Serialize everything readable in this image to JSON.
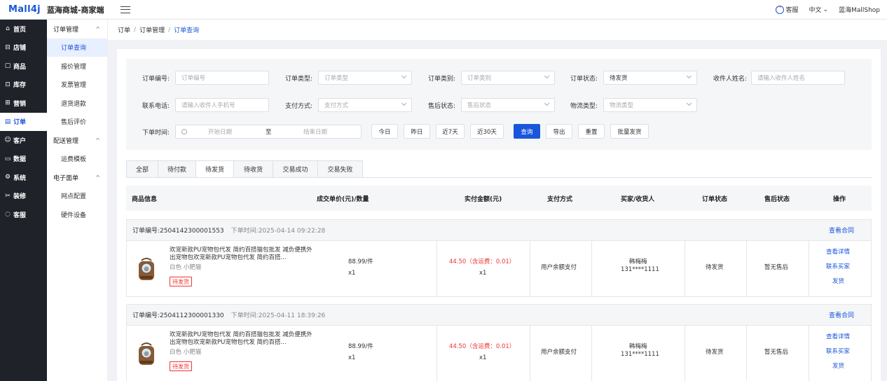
{
  "header": {
    "logo": "Mall4j",
    "title": "蓝海商城-商家端",
    "service": "客服",
    "language": "中文",
    "shop": "蓝海MallShop"
  },
  "sidebar": {
    "items": [
      {
        "icon": "home-icon",
        "label": "首页"
      },
      {
        "icon": "store-icon",
        "label": "店铺"
      },
      {
        "icon": "goods-icon",
        "label": "商品"
      },
      {
        "icon": "warehouse-icon",
        "label": "库存"
      },
      {
        "icon": "gift-icon",
        "label": "营销"
      },
      {
        "icon": "order-icon",
        "label": "订单"
      },
      {
        "icon": "customer-icon",
        "label": "客户"
      },
      {
        "icon": "data-icon",
        "label": "数据"
      },
      {
        "icon": "system-icon",
        "label": "系统"
      },
      {
        "icon": "decorate-icon",
        "label": "装修"
      },
      {
        "icon": "chat-icon",
        "label": "客服"
      }
    ]
  },
  "submenu": {
    "groups": [
      {
        "title": "订单管理",
        "items": [
          "订单查询",
          "报价管理",
          "发票管理",
          "退货退款",
          "售后评价"
        ]
      },
      {
        "title": "配送管理",
        "items": [
          "运费模板"
        ]
      },
      {
        "title": "电子面单",
        "items": [
          "网点配置",
          "硬件设备"
        ]
      }
    ]
  },
  "breadcrumb": [
    "订单",
    "订单管理",
    "订单查询"
  ],
  "filters": {
    "order_no": {
      "label": "订单编号:",
      "placeholder": "订单编号"
    },
    "order_type": {
      "label": "订单类型:",
      "placeholder": "订单类型"
    },
    "order_category": {
      "label": "订单类别:",
      "placeholder": "订单类别"
    },
    "order_status": {
      "label": "订单状态:",
      "value": "待发货"
    },
    "receiver_name": {
      "label": "收件人姓名:",
      "placeholder": "请输入收件人姓名"
    },
    "phone": {
      "label": "联系电话:",
      "placeholder": "请输入收件人手机号"
    },
    "pay_method": {
      "label": "支付方式:",
      "placeholder": "支付方式"
    },
    "after_sale": {
      "label": "售后状态:",
      "placeholder": "售后状态"
    },
    "logistics": {
      "label": "物流类型:",
      "placeholder": "物流类型"
    },
    "order_time": {
      "label": "下单时间:",
      "start": "开始日期",
      "to": "至",
      "end": "结束日期"
    },
    "quick": [
      "今日",
      "昨日",
      "近7天",
      "近30天"
    ],
    "actions": {
      "query": "查询",
      "export": "导出",
      "reset": "重置",
      "batch": "批量发货"
    }
  },
  "tabs": [
    "全部",
    "待付款",
    "待发货",
    "待收货",
    "交易成功",
    "交易失败"
  ],
  "table_head": {
    "product": "商品信息",
    "price_qty": "成交单价(元)/数量",
    "paid": "实付金额(元)",
    "pay_method": "支付方式",
    "buyer": "买家/收货人",
    "status": "订单状态",
    "after_sale": "售后状态",
    "ops": "操作"
  },
  "orders": [
    {
      "order_no": "订单编号:2504142300001553",
      "time": "下单时间:2025-04-14 09:22:28",
      "contract": "查看合同",
      "product_name": "欢宠新款PU宠物包代发 简约百搭猫包批发 减负便携外出宠物包欢宠新款PU宠物包代发 简约百搭...",
      "spec": "白色 小肥猫",
      "badge": "待发货",
      "price": "88.99/件",
      "qty": "x1",
      "paid": "44.50（含运费：0.01）",
      "paid_qty": "x1",
      "pay_method": "用户余额支付",
      "buyer": "韩梅梅",
      "buyer_phone": "131****1111",
      "status": "待发货",
      "after_sale": "暂无售后",
      "ops": [
        "查看详情",
        "联系买家",
        "发货"
      ]
    },
    {
      "order_no": "订单编号:2504112300001330",
      "time": "下单时间:2025-04-11 18:39:26",
      "contract": "查看合同",
      "product_name": "欢宠新款PU宠物包代发 简约百搭猫包批发 减负便携外出宠物包欢宠新款PU宠物包代发 简约百搭...",
      "spec": "白色 小肥猫",
      "badge": "待发货",
      "price": "88.99/件",
      "qty": "x1",
      "paid": "44.50（含运费：0.01）",
      "paid_qty": "x1",
      "pay_method": "用户余额支付",
      "buyer": "韩梅梅",
      "buyer_phone": "131****1111",
      "status": "待发货",
      "after_sale": "暂无售后",
      "ops": [
        "查看详情",
        "联系买家",
        "发货"
      ]
    }
  ]
}
